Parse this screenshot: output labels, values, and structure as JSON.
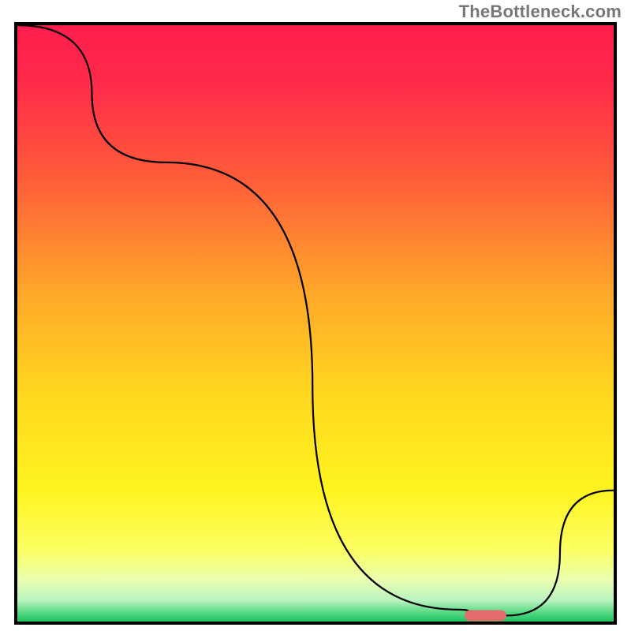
{
  "watermark": "TheBottleneck.com",
  "chart_data": {
    "type": "line",
    "title": "",
    "xlabel": "",
    "ylabel": "",
    "xlim": [
      0,
      100
    ],
    "ylim": [
      0,
      100
    ],
    "series": [
      {
        "name": "bottleneck-curve",
        "x": [
          0,
          25,
          74,
          78,
          82,
          100
        ],
        "y": [
          100,
          77,
          2,
          1,
          1,
          22
        ]
      }
    ],
    "marker": {
      "x_start": 75,
      "x_end": 82,
      "y": 1
    },
    "background_gradient": {
      "stops": [
        {
          "offset": 0.0,
          "color": "#ff1d4d"
        },
        {
          "offset": 0.1,
          "color": "#ff2b4a"
        },
        {
          "offset": 0.25,
          "color": "#ff5a3a"
        },
        {
          "offset": 0.45,
          "color": "#ffa829"
        },
        {
          "offset": 0.62,
          "color": "#ffd81f"
        },
        {
          "offset": 0.78,
          "color": "#fff41f"
        },
        {
          "offset": 0.88,
          "color": "#fbff62"
        },
        {
          "offset": 0.93,
          "color": "#eaffb0"
        },
        {
          "offset": 0.965,
          "color": "#b9f3c0"
        },
        {
          "offset": 0.985,
          "color": "#56d884"
        },
        {
          "offset": 1.0,
          "color": "#1ec25e"
        }
      ]
    }
  }
}
